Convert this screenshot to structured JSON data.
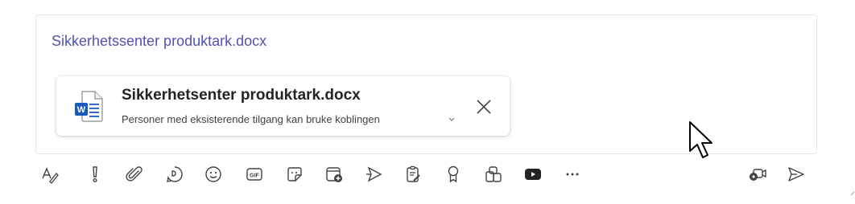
{
  "message": {
    "link_text": "Sikkerhetssenter produktark.docx"
  },
  "attachment": {
    "icon": "word-doc-icon",
    "title": "Sikkerhetsenter produktark.docx",
    "permission_text": "Personer med eksisterende tilgang kan bruke koblingen",
    "accent_color": "#185abd"
  },
  "toolbar": {
    "icons": [
      "format-icon",
      "important-icon",
      "attach-icon",
      "loop-icon",
      "emoji-icon",
      "gif-icon",
      "sticker-icon",
      "schedule-meeting-icon",
      "stream-icon",
      "approvals-icon",
      "praise-icon",
      "apps-icon",
      "youtube-icon",
      "more-icon",
      "meet-now-icon",
      "send-icon"
    ]
  }
}
